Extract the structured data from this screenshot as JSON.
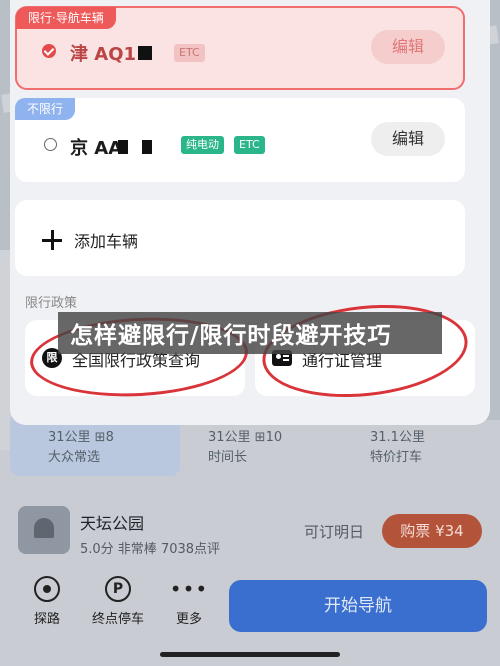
{
  "vehicles": [
    {
      "tag": "限行·导航车辆",
      "plate": "津 AQ1",
      "chips": [
        "ETC"
      ],
      "edit_label": "编辑"
    },
    {
      "tag": "不限行",
      "plate": "京 AA",
      "chips": [
        "纯电动",
        "ETC"
      ],
      "edit_label": "编辑"
    }
  ],
  "add_vehicle_label": "添加车辆",
  "policy": {
    "section_title": "限行政策",
    "query_label": "全国限行政策查询",
    "query_icon_text": "限",
    "pass_label": "通行证管理"
  },
  "overlay_title": "怎样避限行/限行时段避开技巧",
  "routes": [
    {
      "line1": "31公里 ⊞8",
      "line2": "大众常选"
    },
    {
      "line1": "31公里 ⊞10",
      "line2": "时间长"
    },
    {
      "line1": "31.1公里",
      "line2": "特价打车"
    }
  ],
  "poi": {
    "name": "天坛公园",
    "meta": "5.0分  非常棒  7038点评",
    "availability": "可订明日",
    "buy_label": "购票 ¥34"
  },
  "actions": [
    {
      "label": "探路",
      "icon": "radar-icon"
    },
    {
      "label": "终点停车",
      "icon": "parking-icon",
      "glyph": "P"
    },
    {
      "label": "更多",
      "icon": "more-icon",
      "glyph": "•••"
    }
  ],
  "start_nav_label": "开始导航",
  "colors": {
    "restricted_accent": "#ee5a5a",
    "electric_chip": "#2ab68a",
    "nav_button": "#3a6fd0"
  }
}
